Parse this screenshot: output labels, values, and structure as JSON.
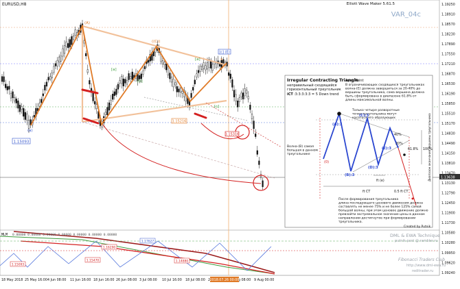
{
  "window": {
    "symbol_tf": "EURUSD,H8",
    "app_title": "Elliott Wave Maker 5.61.5",
    "var_label": "VAR_04c"
  },
  "price_axis": {
    "labels": [
      "1.19250",
      "1.18910",
      "1.18570",
      "1.18230",
      "1.17890",
      "1.17550",
      "1.17210",
      "1.16870",
      "1.16530",
      "1.16190",
      "1.15850",
      "1.15510",
      "1.15170",
      "1.14830",
      "1.14490",
      "1.14150",
      "1.13810",
      "1.13470",
      "1.13130",
      "1.12790",
      "1.12450",
      "1.11900",
      "1.11730",
      "1.10580",
      "1.10280",
      "1.09950",
      "1.09620",
      "1.09240"
    ],
    "current_price": "1.13638"
  },
  "time_axis": {
    "labels": [
      "18 May 2018",
      "25 May 16:00",
      "4 Jun 08:00",
      "11 Jun 16:00",
      "18 Jun 16:00",
      "26 Jun 08:00",
      "3 Jul 08:00",
      "10 Jul 16:00",
      "18 Jul 08:00",
      "25 Jul 16:00",
      "1 Aug 08:00",
      "9 Aug 00:00"
    ],
    "highlight": "2018.07.26 00:00"
  },
  "price_labels": {
    "wave_start": "1.15093",
    "wave_b": "1.15216",
    "wave_d": "1.15316",
    "wave_e": "1.17627"
  },
  "wave_labels": {
    "top_a": "(A)",
    "top_c": "((C))",
    "top_e": "((E))",
    "x_label": "x",
    "ef_label": "[c] (E)",
    "a1": "(a)",
    "a2": "(b)",
    "a3": "(c)",
    "a4": "(d)",
    "a5": "(e)",
    "inner_a": "[a]",
    "inner_b": "[b]",
    "inner_c": "[c]"
  },
  "annotation": {
    "title": "Irregular Contracting Triangle",
    "subtitle_lines": [
      "неправильный сходящийся",
      "горизонтальный треугольник"
    ],
    "ict_label": "iCT",
    "ict_value": ":3:3:3:3:3 = 5 Down trend",
    "apex_title": "Apex Point",
    "apex_lines": [
      "В ограничивающих сходящихся треугольниках",
      "волна-(E) должна завершиться за 20-40% до",
      "вершины треугольника, сама вершина должна",
      "быть сформирована в диапазоне 61.8% от",
      "длины максимальной волны."
    ],
    "reversal_lines": [
      "Только четыре разворотные",
      "точки треугольника могут",
      "касаться его образующих"
    ],
    "wave_b_lines": [
      "Волна-(B) самая",
      "большая в данном",
      "треугольнике"
    ],
    "waves": {
      "a": "(A):3",
      "b": "(B):3",
      "c": "(C):3",
      "d": "(D):3",
      "e": "(E):3",
      "zero": "(0)"
    },
    "pct_40": "40%",
    "pct_20": "20%",
    "pct_618": "61.8%",
    "pct_100": "100%",
    "ft_ct": "ft CT",
    "ft_half": "0.5 ft CT",
    "ft_e": "ft (e)",
    "vertical_right": "Диапазон окончания вершины треугольника",
    "bottom_lines": [
      "После формирования треугольника",
      "длина последующего ценового движения должна",
      "составлять не менее 75% и не более 125% самой",
      "большой волны, при этом ценовое движение должно",
      "превзойти экстремальное значение цены в данном",
      "направлении достигнутое при формировании",
      "треугольника."
    ],
    "credit": "Created by Putnik"
  },
  "indicator": {
    "label": "MLM",
    "values": "0.00000 0.00000 0.00000 0.00000 0.00000 0.00000 0.00000",
    "level_labels": [
      "1.15093",
      "1.17627",
      "1.16290",
      "1.15470",
      "1.14880"
    ]
  },
  "watermark": {
    "line1": "DML & EWA Technique",
    "line2": "putnik-post @ rambler.ru",
    "line3": "Fibonacci  Traders  Club",
    "line4": "http://www.dml-ewa.ru",
    "line5": "reditrader.ru"
  },
  "colors": {
    "orange": "#e07b28",
    "peach": "#f2c19a",
    "red": "#d42020",
    "blue": "#3355cc",
    "green": "#3a9a3a",
    "darkred": "#9b1a1a"
  }
}
